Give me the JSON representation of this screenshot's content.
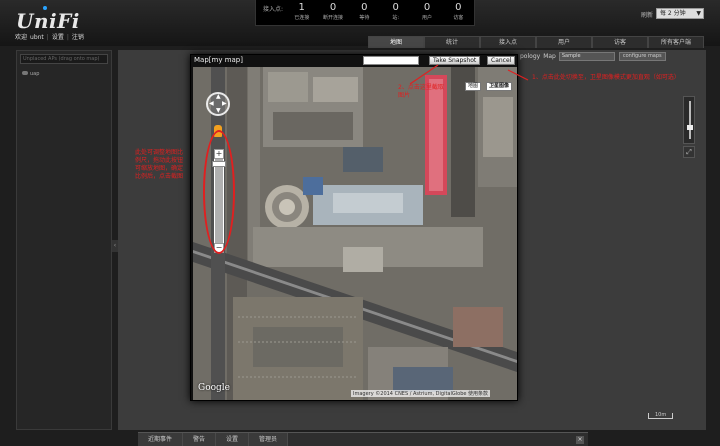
{
  "header": {
    "logo": "UniFi",
    "welcome_prefix": "欢迎",
    "username": "ubnt",
    "settings_link": "设置",
    "logout_link": "注销",
    "stats_label": "接入点:",
    "stats": [
      {
        "value": "1",
        "label": "已连接"
      },
      {
        "value": "0",
        "label": "断开连接"
      },
      {
        "value": "0",
        "label": "等待"
      },
      {
        "value": "0",
        "label": "站:"
      },
      {
        "value": "0",
        "label": "用户"
      },
      {
        "value": "0",
        "label": "访客"
      }
    ],
    "refresh_label": "刷新",
    "refresh_value": "每 2 分钟"
  },
  "tabs": [
    "地图",
    "统计",
    "接入点",
    "用户",
    "访客",
    "所有客户端"
  ],
  "left_panel": {
    "search_placeholder": "Unplaced APs (drag onto map)",
    "devices": [
      "uap"
    ]
  },
  "map_toolbar": {
    "topology_label": "pology",
    "map_label": "Map",
    "map_select": "Sample",
    "configure_button": "configure maps"
  },
  "scale_label": "10m",
  "dialog": {
    "title": "Map[my map]",
    "snapshot_button": "Take Snapshot",
    "cancel_button": "Cancel",
    "map_type_map": "地图",
    "map_type_satellite": "卫星图像",
    "google_logo": "Google",
    "copyright": "Imagery ©2014 CNES / Astrium, DigitalGlobe   使用条款"
  },
  "annotations": {
    "step1": "1、点击此处切换至，卫星图像模式更加直观（如可选）",
    "step2": "2、点击这里截取图片",
    "zoom_hint": "此处可调整地图比例尺，拖动此按钮可缩放地图，确定比例后，点击截图"
  },
  "footer": {
    "tabs": [
      "近期事件",
      "警告",
      "设置",
      "管理员"
    ],
    "close": "×"
  },
  "colors": {
    "annotation": "#e02020",
    "roof_red": "#d4485a"
  }
}
